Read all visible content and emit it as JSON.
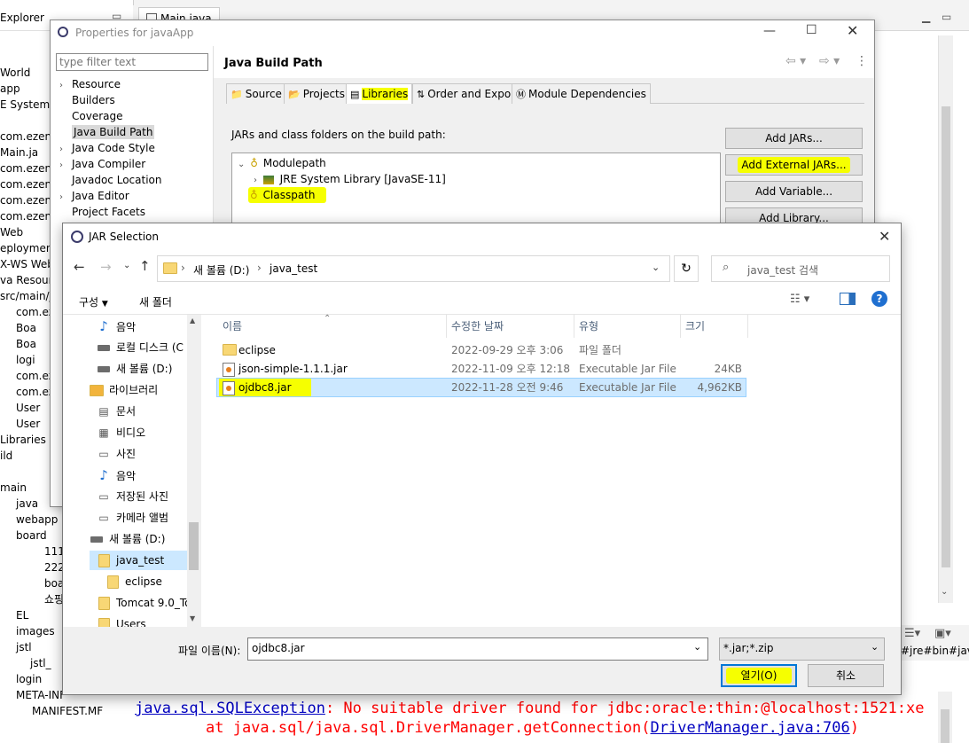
{
  "eclipse": {
    "explorer_title": "Explorer",
    "editor_tab": "Main.java",
    "tree": [
      "World",
      "app",
      "E System L",
      "",
      "com.ezen",
      "Main.ja",
      "com.ezen",
      "com.ezen",
      "com.ezen",
      "com.ezen",
      "Web",
      "eployment",
      "X-WS Web",
      "va Resourc",
      "src/main/j",
      "com.ez",
      "Boa",
      "Boa",
      "logi",
      "com.ez",
      "com.ez",
      "User",
      "User",
      "Libraries",
      "ild",
      "",
      "main",
      "java",
      "webapp",
      "board",
      "111",
      "222",
      "boa",
      "쇼핑",
      "EL",
      "images",
      "jstl",
      "jstl_",
      "login",
      "META-INF",
      "MANIFEST.MF"
    ],
    "console_line1_link": "java.sql.SQLException",
    "console_line1_text": ": No suitable driver found for jdbc:oracle:thin:@localhost:1521:xe",
    "console_line2_prefix": "at java.sql/java.sql.DriverManager.getConnection(",
    "console_line2_link": "DriverManager.java:706",
    "console_line2_suffix": ")",
    "path_fragment": "#jre#bin#jav"
  },
  "properties": {
    "title": "Properties for javaApp",
    "filter_placeholder": "type filter text",
    "nav": [
      {
        "label": "Resource",
        "chevron": true
      },
      {
        "label": "Builders",
        "chevron": false
      },
      {
        "label": "Coverage",
        "chevron": false
      },
      {
        "label": "Java Build Path",
        "chevron": false,
        "selected": true
      },
      {
        "label": "Java Code Style",
        "chevron": true
      },
      {
        "label": "Java Compiler",
        "chevron": true
      },
      {
        "label": "Javadoc Location",
        "chevron": false
      },
      {
        "label": "Java Editor",
        "chevron": true
      },
      {
        "label": "Project Facets",
        "chevron": false
      }
    ],
    "heading": "Java Build Path",
    "tabs": [
      "Source",
      "Projects",
      "Libraries",
      "Order and Export",
      "Module Dependencies"
    ],
    "active_tab": "Libraries",
    "section_label": "JARs and class folders on the build path:",
    "tree": {
      "modulepath": "Modulepath",
      "jre": "JRE System Library [JavaSE-11]",
      "classpath": "Classpath"
    },
    "buttons": [
      "Add JARs...",
      "Add External JARs...",
      "Add Variable...",
      "Add Library..."
    ]
  },
  "jar_dialog": {
    "title": "JAR Selection",
    "breadcrumb": [
      "새 볼륨 (D:)",
      "java_test"
    ],
    "search_placeholder": "java_test 검색",
    "organize_label": "구성",
    "new_folder_label": "새 폴더",
    "nav_items": [
      {
        "label": "음악",
        "type": "music",
        "indent": 1
      },
      {
        "label": "로컬 디스크 (C",
        "type": "drive",
        "indent": 1
      },
      {
        "label": "새 볼륨 (D:)",
        "type": "drive",
        "indent": 1
      },
      {
        "label": "라이브러리",
        "type": "library",
        "indent": 0
      },
      {
        "label": "문서",
        "type": "doc",
        "indent": 1
      },
      {
        "label": "비디오",
        "type": "video",
        "indent": 1
      },
      {
        "label": "사진",
        "type": "photo",
        "indent": 1
      },
      {
        "label": "음악",
        "type": "music",
        "indent": 1
      },
      {
        "label": "저장된 사진",
        "type": "photo",
        "indent": 1
      },
      {
        "label": "카메라 앨범",
        "type": "photo",
        "indent": 1
      },
      {
        "label": "새 볼륨 (D:)",
        "type": "drive",
        "indent": 0
      },
      {
        "label": "java_test",
        "type": "folder",
        "indent": 1,
        "selected": true
      },
      {
        "label": "eclipse",
        "type": "folder",
        "indent": 2
      },
      {
        "label": "Tomcat 9.0_To",
        "type": "folder",
        "indent": 1
      },
      {
        "label": "Users",
        "type": "folder",
        "indent": 1
      }
    ],
    "columns": [
      "이름",
      "수정한 날짜",
      "유형",
      "크기"
    ],
    "files": [
      {
        "name": "eclipse",
        "date": "2022-09-29 오후 3:06",
        "type": "파일 폴더",
        "size": "",
        "icon": "folder"
      },
      {
        "name": "json-simple-1.1.1.jar",
        "date": "2022-11-09 오후 12:18",
        "type": "Executable Jar File",
        "size": "24KB",
        "icon": "jar"
      },
      {
        "name": "ojdbc8.jar",
        "date": "2022-11-28 오전 9:46",
        "type": "Executable Jar File",
        "size": "4,962KB",
        "icon": "jar",
        "selected": true
      }
    ],
    "filename_label": "파일 이름(N):",
    "filename_value": "ojdbc8.jar",
    "filter_value": "*.jar;*.zip",
    "open_label": "열기(O)",
    "cancel_label": "취소"
  },
  "colors": {
    "highlight": "#f6ff00",
    "selection": "#cce8ff",
    "link": "#0000c0",
    "error": "#ff0000"
  }
}
